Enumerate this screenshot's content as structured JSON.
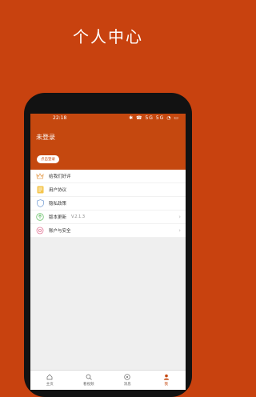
{
  "hero_title": "个人中心",
  "status_bar": {
    "time": "22:18",
    "icons": "✱ ☎ 5G 5G ◔ ▭"
  },
  "header": {
    "title": "未登录",
    "login_button": "点击登录"
  },
  "menu": [
    {
      "label": "给我们好评",
      "icon": "crown-icon"
    },
    {
      "label": "用户协议",
      "icon": "document-icon"
    },
    {
      "label": "隐私政策",
      "icon": "shield-icon"
    },
    {
      "label": "版本更新",
      "version": "V.2.1.3",
      "icon": "update-icon"
    },
    {
      "label": "账户与安全",
      "icon": "gear-icon"
    }
  ],
  "tabs": [
    {
      "label": "主页",
      "icon": "home-icon"
    },
    {
      "label": "看视频",
      "icon": "search-icon"
    },
    {
      "label": "消息",
      "icon": "message-icon"
    },
    {
      "label": "我",
      "icon": "person-icon",
      "active": true
    }
  ],
  "colors": {
    "brand": "#c5480f",
    "background": "#c8420f"
  }
}
